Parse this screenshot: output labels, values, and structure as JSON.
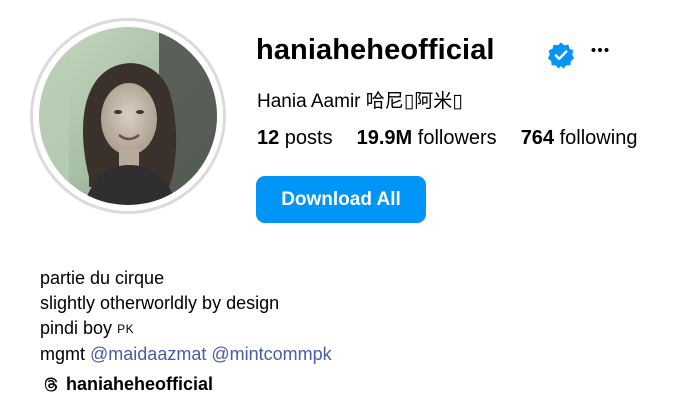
{
  "profile": {
    "username": "haniaheheofficial",
    "full_name": "Hania Aamir 哈尼▯阿米▯",
    "verified_icon": "verified-badge-icon",
    "more_icon": "more-options-icon",
    "avatar_icon": "profile-photo"
  },
  "stats": {
    "posts_count": "12",
    "posts_label": " posts",
    "followers_count": "19.9M",
    "followers_label": " followers",
    "following_count": "764",
    "following_label": " following"
  },
  "actions": {
    "download_all_label": "Download All"
  },
  "bio": {
    "line1": "partie du cirque",
    "line2": "slightly otherworldly by design",
    "line3_text": "pindi boy ",
    "line3_code": "PK",
    "line4_prefix": "mgmt ",
    "mention1": "@maidaazmat",
    "mention2": "@mintcommpk"
  },
  "threads": {
    "icon": "threads-icon",
    "handle": "haniaheheofficial"
  },
  "colors": {
    "accent": "#0095f6",
    "mention": "#4a5ba8",
    "ring": "#dbdbdb"
  }
}
